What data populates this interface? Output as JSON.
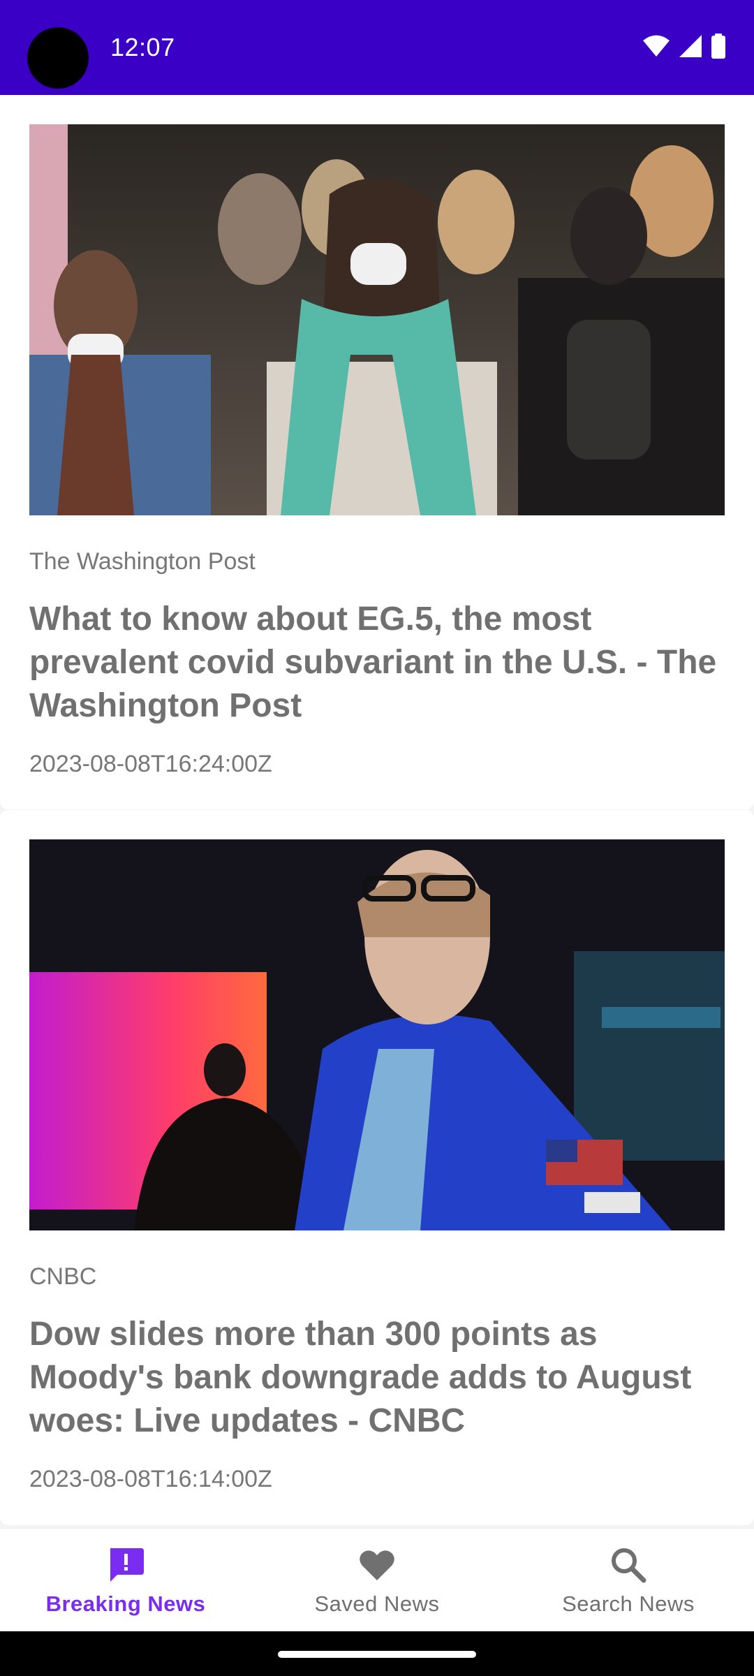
{
  "status_bar": {
    "time": "12:07",
    "icons": [
      "wifi-icon",
      "signal-icon",
      "battery-icon"
    ],
    "color": "#3a00c5"
  },
  "articles": [
    {
      "source": "The Washington Post",
      "title": "What to know about EG.5, the most prevalent covid subvariant in the U.S. - The Washington Post",
      "published": "2023-08-08T16:24:00Z"
    },
    {
      "source": "CNBC",
      "title": "Dow slides more than 300 points as Moody's bank downgrade adds to August woes: Live updates - CNBC",
      "published": "2023-08-08T16:14:00Z"
    }
  ],
  "bottom_nav": {
    "items": [
      {
        "label": "Breaking News",
        "icon": "alert-icon",
        "active": true
      },
      {
        "label": "Saved News",
        "icon": "heart-icon",
        "active": false
      },
      {
        "label": "Search News",
        "icon": "search-icon",
        "active": false
      }
    ],
    "active_color": "#7a2cf0",
    "inactive_color": "#6f6f6f"
  }
}
